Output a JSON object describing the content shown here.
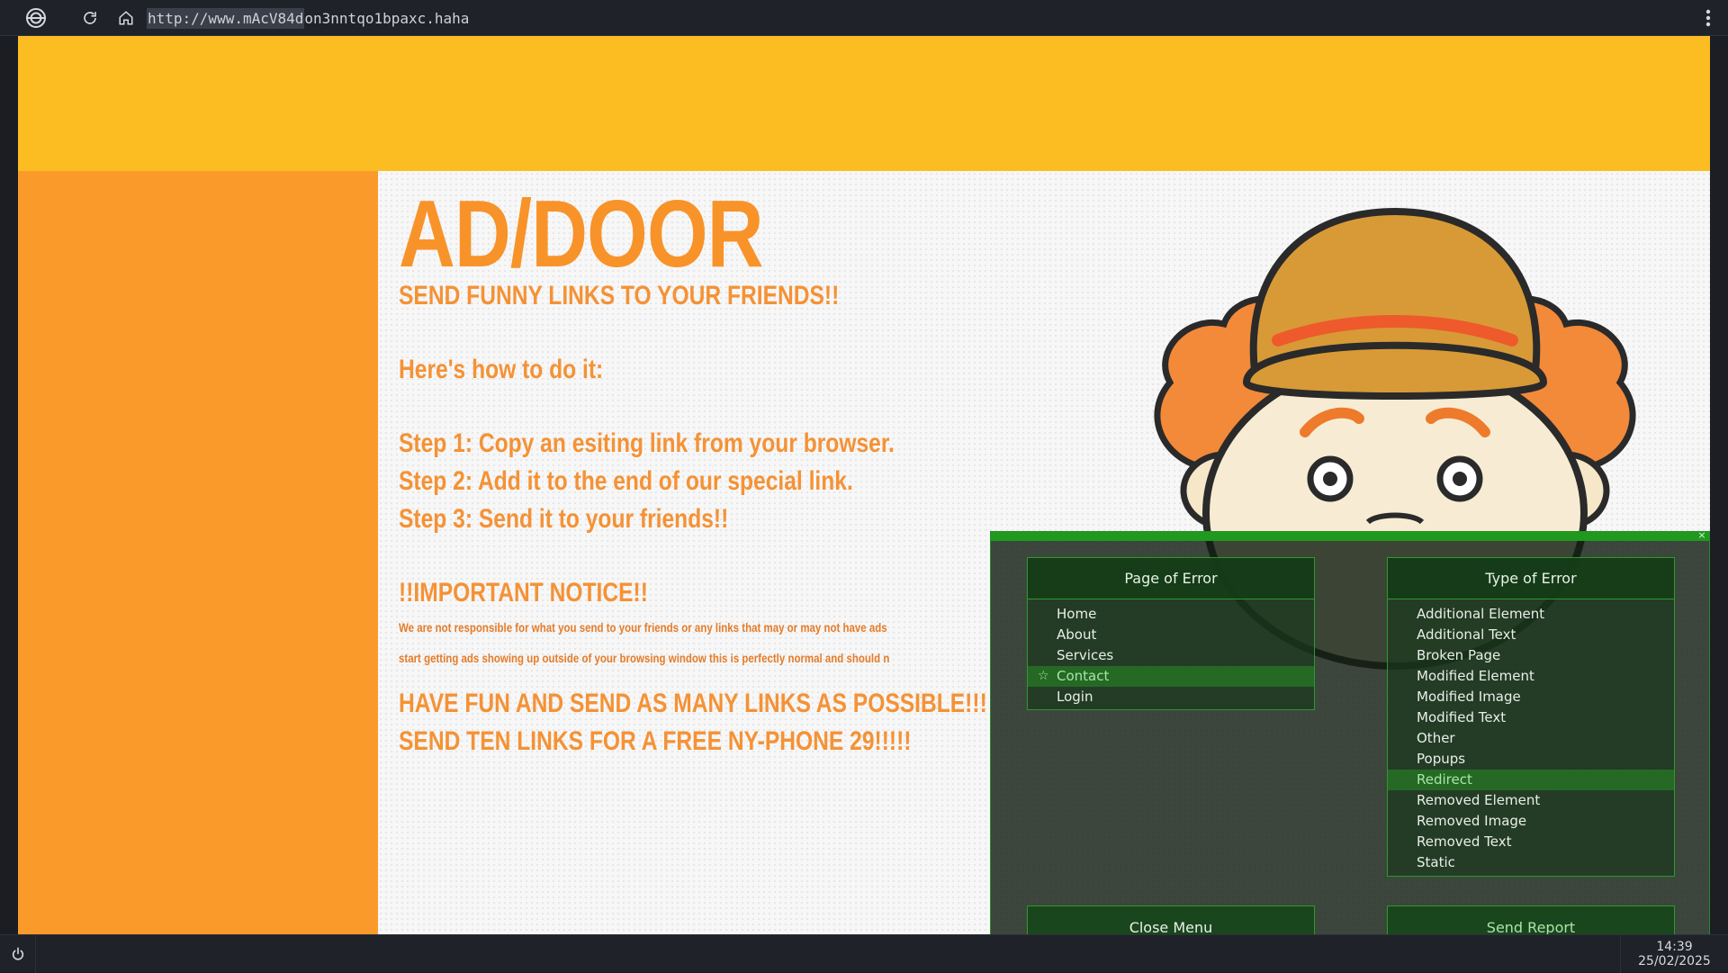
{
  "browser": {
    "url_selected": "http://www.mAcV84d",
    "url_rest": "on3nntqo1bpaxc.haha",
    "icons": [
      "browser-logo-icon",
      "reload-icon",
      "home-icon",
      "kebab-menu-icon"
    ]
  },
  "page": {
    "title": "AD/DOOR",
    "tagline": "SEND FUNNY LINKS TO YOUR FRIENDS!!",
    "howto": "Here's how to do it:",
    "steps": [
      "Step 1: Copy an esiting link from your browser.",
      "Step 2: Add it to the end of our special link.",
      "Step 3: Send it to your friends!!"
    ],
    "notice_heading": "!!IMPORTANT NOTICE!!",
    "notice_line1": "We are not responsible for what you send to your friends or any links that may or may not have ads",
    "notice_line2": "start getting ads showing up outside of your browsing window this is perfectly normal and should n",
    "promo1": "HAVE FUN AND SEND AS MANY LINKS AS POSSIBLE!!!",
    "promo2": "SEND TEN LINKS FOR A FREE NY-PHONE 29!!!!!",
    "colors": {
      "banner": "#fbbd22",
      "sidebar": "#fa9a2a",
      "text": "#f59235"
    }
  },
  "dialog": {
    "close_glyph": "×",
    "page_header": "Page of Error",
    "page_options": [
      "Home",
      "About",
      "Services",
      "Contact",
      "Login"
    ],
    "page_selected": "Contact",
    "type_header": "Type of Error",
    "type_options": [
      "Additional Element",
      "Additional Text",
      "Broken Page",
      "Modified Element",
      "Modified Image",
      "Modified Text",
      "Other",
      "Popups",
      "Redirect",
      "Removed Element",
      "Removed Image",
      "Removed Text",
      "Static"
    ],
    "type_selected": "Redirect",
    "close_button": "Close Menu",
    "send_button": "Send Report",
    "colors": {
      "accent": "#1f9a1f",
      "selected_text": "#a6e6a6"
    }
  },
  "taskbar": {
    "time": "14:39",
    "date": "25/02/2025",
    "icons": [
      "power-icon"
    ]
  }
}
